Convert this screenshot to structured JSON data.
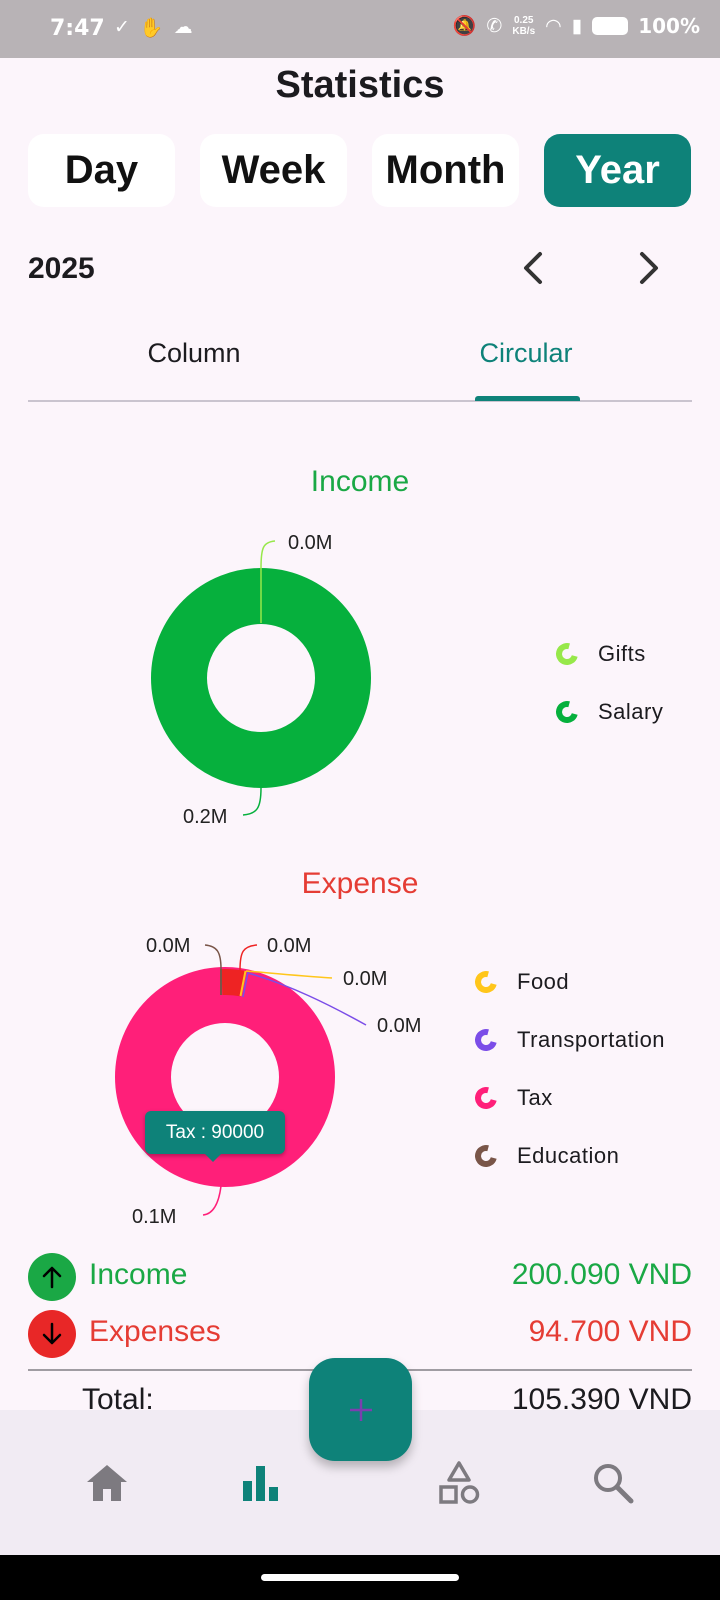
{
  "status_bar": {
    "time": "7:47",
    "net_speed_value": "0.25",
    "net_speed_unit": "KB/s",
    "battery": "100%"
  },
  "page_title": "Statistics",
  "period_tabs": [
    {
      "label": "Day",
      "active": false
    },
    {
      "label": "Week",
      "active": false
    },
    {
      "label": "Month",
      "active": false
    },
    {
      "label": "Year",
      "active": true
    }
  ],
  "year_selector": {
    "label": "2025",
    "prev_icon": "chevron-left-icon",
    "next_icon": "chevron-right-icon"
  },
  "view_tabs": [
    {
      "label": "Column",
      "active": false
    },
    {
      "label": "Circular",
      "active": true
    }
  ],
  "income_chart": {
    "title": "Income",
    "label_top": "0.0M",
    "label_bottom": "0.2M",
    "legend": [
      {
        "name": "Gifts",
        "color": "#97e84a"
      },
      {
        "name": "Salary",
        "color": "#06b03d"
      }
    ]
  },
  "expense_chart": {
    "title": "Expense",
    "labels": [
      "0.0M",
      "0.0M",
      "0.0M",
      "0.0M",
      "0.1M"
    ],
    "tooltip": "Tax : 90000",
    "legend": [
      {
        "name": "Food",
        "color": "#ffc61b"
      },
      {
        "name": "Transportation",
        "color": "#7b4de8"
      },
      {
        "name": "Tax",
        "color": "#ff1f79"
      },
      {
        "name": "Education",
        "color": "#795548"
      }
    ]
  },
  "summary": {
    "income_label": "Income",
    "income_value": "200.090 VND",
    "expenses_label": "Expenses",
    "expenses_value": "94.700 VND",
    "total_label": "Total:",
    "total_value": "105.390 VND"
  },
  "colors": {
    "accent": "#0e8279",
    "income": "#1aa845",
    "expense": "#e53c34",
    "income_slice": "#06b03d",
    "tax_slice": "#ff1f79",
    "red_slice": "#ee2323"
  },
  "bottom_nav": [
    "home-icon",
    "bar-chart-icon",
    "shapes-icon",
    "search-icon"
  ],
  "fab_icon": "plus-icon"
}
